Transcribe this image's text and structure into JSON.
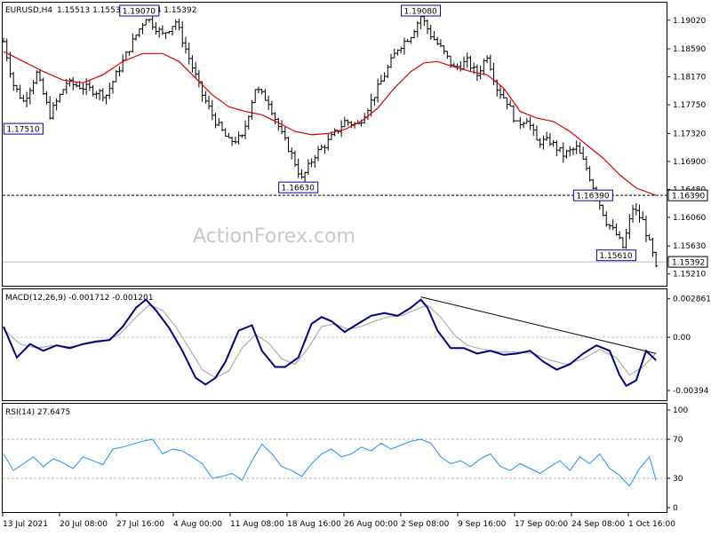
{
  "header": {
    "symbol": "EURUSD,H4",
    "ohlc": "1.15513 1.15535 1.15284 1.15392"
  },
  "watermark": "ActionForex.com",
  "colors": {
    "candle": "#000000",
    "ma": "#dd0000",
    "macd": "#000080",
    "signal": "#a0a0a0",
    "rsi": "#1e90ff",
    "trendline": "#000000",
    "grid_dashed": "#b0b0b0",
    "support_line": "#000000"
  },
  "chart_data": [
    {
      "type": "candlestick",
      "name": "EURUSD,H4",
      "y_ticks": [
        "1.19020",
        "1.18590",
        "1.18170",
        "1.17750",
        "1.17320",
        "1.16900",
        "1.16480",
        "1.16060",
        "1.15630",
        "1.15210"
      ],
      "y_tick_values": [
        1.1902,
        1.1859,
        1.1817,
        1.1775,
        1.1732,
        1.169,
        1.1648,
        1.1606,
        1.1563,
        1.1521
      ],
      "ylim": [
        1.1506,
        1.1927
      ],
      "x_ticks": [
        "13 Jul 2021",
        "20 Jul 08:00",
        "27 Jul 16:00",
        "4 Aug 00:00",
        "11 Aug 08:00",
        "18 Aug 16:00",
        "26 Aug 00:00",
        "2 Sep 08:00",
        "9 Sep 16:00",
        "17 Sep 00:00",
        "24 Sep 08:00",
        "1 Oct 16:00"
      ],
      "price_path": [
        [
          0,
          1.187
        ],
        [
          6,
          1.1805
        ],
        [
          12,
          1.178
        ],
        [
          20,
          1.1822
        ],
        [
          28,
          1.176
        ],
        [
          38,
          1.1808
        ],
        [
          50,
          1.18
        ],
        [
          62,
          1.179
        ],
        [
          72,
          1.184
        ],
        [
          80,
          1.188
        ],
        [
          86,
          1.1907
        ],
        [
          96,
          1.188
        ],
        [
          104,
          1.19
        ],
        [
          112,
          1.1845
        ],
        [
          120,
          1.179
        ],
        [
          128,
          1.175
        ],
        [
          136,
          1.172
        ],
        [
          144,
          1.1725
        ],
        [
          152,
          1.18
        ],
        [
          160,
          1.178
        ],
        [
          168,
          1.173
        ],
        [
          174,
          1.17
        ],
        [
          180,
          1.1663
        ],
        [
          188,
          1.17
        ],
        [
          196,
          1.172
        ],
        [
          206,
          1.175
        ],
        [
          214,
          1.1745
        ],
        [
          222,
          1.178
        ],
        [
          230,
          1.182
        ],
        [
          238,
          1.186
        ],
        [
          246,
          1.188
        ],
        [
          252,
          1.1908
        ],
        [
          258,
          1.188
        ],
        [
          264,
          1.186
        ],
        [
          272,
          1.183
        ],
        [
          280,
          1.184
        ],
        [
          286,
          1.182
        ],
        [
          292,
          1.185
        ],
        [
          298,
          1.18
        ],
        [
          304,
          1.178
        ],
        [
          310,
          1.1745
        ],
        [
          316,
          1.1755
        ],
        [
          322,
          1.172
        ],
        [
          330,
          1.172
        ],
        [
          338,
          1.17
        ],
        [
          346,
          1.171
        ],
        [
          352,
          1.168
        ],
        [
          358,
          1.1639
        ],
        [
          364,
          1.16
        ],
        [
          370,
          1.158
        ],
        [
          374,
          1.1561
        ],
        [
          380,
          1.162
        ],
        [
          386,
          1.16
        ],
        [
          392,
          1.155
        ],
        [
          394,
          1.1528
        ]
      ],
      "ma_path": [
        [
          0,
          1.1855
        ],
        [
          12,
          1.184
        ],
        [
          24,
          1.1825
        ],
        [
          36,
          1.1812
        ],
        [
          48,
          1.1808
        ],
        [
          60,
          1.182
        ],
        [
          72,
          1.184
        ],
        [
          84,
          1.1852
        ],
        [
          96,
          1.1852
        ],
        [
          106,
          1.184
        ],
        [
          116,
          1.1815
        ],
        [
          126,
          1.179
        ],
        [
          136,
          1.1772
        ],
        [
          146,
          1.1765
        ],
        [
          156,
          1.176
        ],
        [
          166,
          1.1748
        ],
        [
          176,
          1.1735
        ],
        [
          186,
          1.173
        ],
        [
          196,
          1.1732
        ],
        [
          206,
          1.1738
        ],
        [
          216,
          1.175
        ],
        [
          226,
          1.177
        ],
        [
          236,
          1.18
        ],
        [
          246,
          1.1825
        ],
        [
          254,
          1.1838
        ],
        [
          262,
          1.184
        ],
        [
          272,
          1.1832
        ],
        [
          282,
          1.1825
        ],
        [
          292,
          1.182
        ],
        [
          302,
          1.18
        ],
        [
          312,
          1.1765
        ],
        [
          322,
          1.1755
        ],
        [
          332,
          1.175
        ],
        [
          342,
          1.1735
        ],
        [
          352,
          1.1715
        ],
        [
          362,
          1.1695
        ],
        [
          372,
          1.167
        ],
        [
          382,
          1.165
        ],
        [
          394,
          1.1639
        ]
      ],
      "dashed_level": 1.1639,
      "last_price": 1.15392,
      "right_labels": [
        {
          "text": "1.16390",
          "value": 1.1639
        },
        {
          "text": "1.15392",
          "value": 1.15392
        }
      ],
      "annotations": [
        {
          "text": "1.19070",
          "x": 82,
          "value": 1.1907,
          "anchor": "top"
        },
        {
          "text": "1.19080",
          "x": 252,
          "value": 1.1908,
          "anchor": "top"
        },
        {
          "text": "1.17510",
          "x": 12,
          "value": 1.1751,
          "anchor": "bottom"
        },
        {
          "text": "1.16630",
          "x": 178,
          "value": 1.1663,
          "anchor": "bottom"
        },
        {
          "text": "1.16390",
          "x": 356,
          "value": 1.1639,
          "anchor": "box"
        },
        {
          "text": "1.15610",
          "x": 370,
          "value": 1.1561,
          "anchor": "bottom"
        }
      ]
    },
    {
      "type": "line",
      "name": "MACD(12,26,9)",
      "header_text": "MACD(12,26,9) -0.001712 -0.001201",
      "y_ticks": [
        "0.002861",
        "0.00",
        "-0.00394"
      ],
      "y_tick_values": [
        0.002861,
        0.0,
        -0.00394
      ],
      "ylim": [
        -0.0046,
        0.0033
      ],
      "zero_line": 0.0,
      "series": [
        {
          "name": "MACD",
          "x": [
            0,
            8,
            16,
            24,
            32,
            40,
            48,
            56,
            64,
            72,
            80,
            86,
            92,
            100,
            108,
            116,
            122,
            128,
            134,
            142,
            150,
            156,
            164,
            170,
            178,
            186,
            192,
            198,
            206,
            214,
            222,
            230,
            238,
            246,
            252,
            256,
            262,
            270,
            278,
            286,
            294,
            302,
            310,
            318,
            326,
            334,
            342,
            350,
            358,
            366,
            372,
            376,
            382,
            388,
            394
          ],
          "y": [
            0.0008,
            -0.0015,
            -0.0005,
            -0.001,
            -0.0006,
            -0.0008,
            -0.0005,
            -0.0003,
            -0.0002,
            0.0008,
            0.0022,
            0.0028,
            0.002,
            0.0007,
            -0.001,
            -0.003,
            -0.0035,
            -0.003,
            -0.0018,
            0.0005,
            0.0009,
            -0.001,
            -0.0022,
            -0.0022,
            -0.0015,
            0.001,
            0.0015,
            0.0012,
            0.0004,
            0.001,
            0.0016,
            0.0018,
            0.0016,
            0.0022,
            0.0028,
            0.0022,
            0.0005,
            -0.0008,
            -0.0008,
            -0.0012,
            -0.001,
            -0.0013,
            -0.0012,
            -0.001,
            -0.0018,
            -0.0024,
            -0.002,
            -0.0012,
            -0.0006,
            -0.001,
            -0.0028,
            -0.0036,
            -0.0032,
            -0.001,
            -0.0017
          ]
        },
        {
          "name": "Signal",
          "x": [
            0,
            10,
            20,
            30,
            40,
            50,
            60,
            70,
            80,
            88,
            96,
            104,
            112,
            120,
            128,
            136,
            144,
            152,
            160,
            168,
            176,
            184,
            192,
            200,
            208,
            216,
            224,
            232,
            240,
            248,
            256,
            264,
            272,
            280,
            290,
            300,
            310,
            320,
            330,
            340,
            350,
            360,
            370,
            378,
            386,
            394
          ],
          "y": [
            0.0006,
            -0.0005,
            -0.0008,
            -0.0006,
            -0.0007,
            -0.0005,
            -0.0003,
            0.0002,
            0.0015,
            0.0024,
            0.002,
            0.0008,
            -0.0008,
            -0.0024,
            -0.003,
            -0.0025,
            -0.0008,
            0.0002,
            -0.0004,
            -0.0016,
            -0.002,
            -0.0008,
            0.0008,
            0.001,
            0.0006,
            0.0008,
            0.0012,
            0.0015,
            0.0016,
            0.002,
            0.0024,
            0.0015,
            0.0002,
            -0.0006,
            -0.0009,
            -0.0011,
            -0.0011,
            -0.0012,
            -0.0017,
            -0.002,
            -0.0016,
            -0.0009,
            -0.0015,
            -0.0028,
            -0.0022,
            -0.0012
          ]
        }
      ],
      "trendline": [
        [
          252,
          0.003
        ],
        [
          394,
          -0.0012
        ]
      ]
    },
    {
      "type": "line",
      "name": "RSI(14)",
      "header_text": "RSI(14) 27.6475",
      "y_ticks": [
        "100",
        "70",
        "30",
        "0"
      ],
      "y_tick_values": [
        100,
        70,
        30,
        0
      ],
      "ylim": [
        0,
        100
      ],
      "dashed_levels": [
        70,
        30
      ],
      "series": [
        {
          "name": "RSI",
          "x": [
            0,
            6,
            12,
            18,
            24,
            30,
            36,
            42,
            48,
            54,
            60,
            66,
            72,
            78,
            84,
            90,
            96,
            102,
            108,
            114,
            120,
            126,
            132,
            138,
            144,
            150,
            156,
            162,
            168,
            174,
            180,
            186,
            192,
            198,
            204,
            210,
            216,
            222,
            228,
            234,
            240,
            246,
            252,
            258,
            264,
            270,
            276,
            282,
            288,
            294,
            300,
            306,
            312,
            318,
            324,
            330,
            336,
            342,
            348,
            354,
            360,
            366,
            372,
            378,
            384,
            390,
            394
          ],
          "y": [
            55,
            38,
            45,
            52,
            42,
            50,
            46,
            40,
            52,
            48,
            44,
            60,
            62,
            65,
            68,
            70,
            55,
            60,
            58,
            52,
            45,
            30,
            32,
            35,
            28,
            48,
            65,
            55,
            42,
            38,
            32,
            45,
            55,
            60,
            52,
            55,
            62,
            58,
            66,
            60,
            64,
            68,
            70,
            66,
            52,
            45,
            48,
            42,
            50,
            55,
            42,
            38,
            45,
            40,
            35,
            42,
            48,
            38,
            52,
            45,
            55,
            40,
            33,
            22,
            40,
            52,
            28
          ]
        }
      ]
    }
  ]
}
